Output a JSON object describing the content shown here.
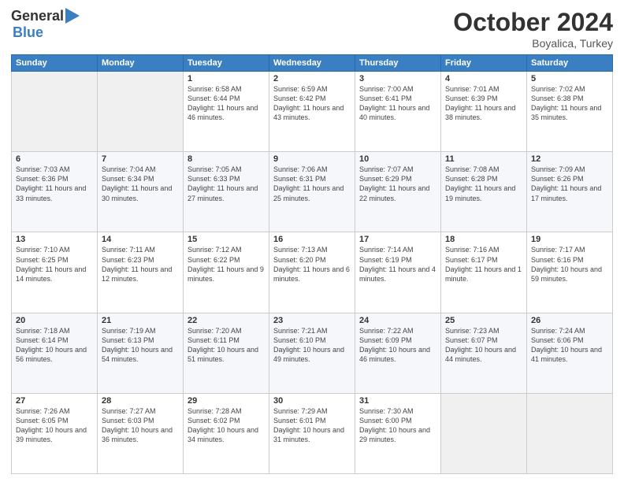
{
  "logo": {
    "general": "General",
    "blue": "Blue"
  },
  "header": {
    "month": "October 2024",
    "location": "Boyalica, Turkey"
  },
  "weekdays": [
    "Sunday",
    "Monday",
    "Tuesday",
    "Wednesday",
    "Thursday",
    "Friday",
    "Saturday"
  ],
  "weeks": [
    [
      {
        "day": "",
        "sunrise": "",
        "sunset": "",
        "daylight": ""
      },
      {
        "day": "",
        "sunrise": "",
        "sunset": "",
        "daylight": ""
      },
      {
        "day": "1",
        "sunrise": "Sunrise: 6:58 AM",
        "sunset": "Sunset: 6:44 PM",
        "daylight": "Daylight: 11 hours and 46 minutes."
      },
      {
        "day": "2",
        "sunrise": "Sunrise: 6:59 AM",
        "sunset": "Sunset: 6:42 PM",
        "daylight": "Daylight: 11 hours and 43 minutes."
      },
      {
        "day": "3",
        "sunrise": "Sunrise: 7:00 AM",
        "sunset": "Sunset: 6:41 PM",
        "daylight": "Daylight: 11 hours and 40 minutes."
      },
      {
        "day": "4",
        "sunrise": "Sunrise: 7:01 AM",
        "sunset": "Sunset: 6:39 PM",
        "daylight": "Daylight: 11 hours and 38 minutes."
      },
      {
        "day": "5",
        "sunrise": "Sunrise: 7:02 AM",
        "sunset": "Sunset: 6:38 PM",
        "daylight": "Daylight: 11 hours and 35 minutes."
      }
    ],
    [
      {
        "day": "6",
        "sunrise": "Sunrise: 7:03 AM",
        "sunset": "Sunset: 6:36 PM",
        "daylight": "Daylight: 11 hours and 33 minutes."
      },
      {
        "day": "7",
        "sunrise": "Sunrise: 7:04 AM",
        "sunset": "Sunset: 6:34 PM",
        "daylight": "Daylight: 11 hours and 30 minutes."
      },
      {
        "day": "8",
        "sunrise": "Sunrise: 7:05 AM",
        "sunset": "Sunset: 6:33 PM",
        "daylight": "Daylight: 11 hours and 27 minutes."
      },
      {
        "day": "9",
        "sunrise": "Sunrise: 7:06 AM",
        "sunset": "Sunset: 6:31 PM",
        "daylight": "Daylight: 11 hours and 25 minutes."
      },
      {
        "day": "10",
        "sunrise": "Sunrise: 7:07 AM",
        "sunset": "Sunset: 6:29 PM",
        "daylight": "Daylight: 11 hours and 22 minutes."
      },
      {
        "day": "11",
        "sunrise": "Sunrise: 7:08 AM",
        "sunset": "Sunset: 6:28 PM",
        "daylight": "Daylight: 11 hours and 19 minutes."
      },
      {
        "day": "12",
        "sunrise": "Sunrise: 7:09 AM",
        "sunset": "Sunset: 6:26 PM",
        "daylight": "Daylight: 11 hours and 17 minutes."
      }
    ],
    [
      {
        "day": "13",
        "sunrise": "Sunrise: 7:10 AM",
        "sunset": "Sunset: 6:25 PM",
        "daylight": "Daylight: 11 hours and 14 minutes."
      },
      {
        "day": "14",
        "sunrise": "Sunrise: 7:11 AM",
        "sunset": "Sunset: 6:23 PM",
        "daylight": "Daylight: 11 hours and 12 minutes."
      },
      {
        "day": "15",
        "sunrise": "Sunrise: 7:12 AM",
        "sunset": "Sunset: 6:22 PM",
        "daylight": "Daylight: 11 hours and 9 minutes."
      },
      {
        "day": "16",
        "sunrise": "Sunrise: 7:13 AM",
        "sunset": "Sunset: 6:20 PM",
        "daylight": "Daylight: 11 hours and 6 minutes."
      },
      {
        "day": "17",
        "sunrise": "Sunrise: 7:14 AM",
        "sunset": "Sunset: 6:19 PM",
        "daylight": "Daylight: 11 hours and 4 minutes."
      },
      {
        "day": "18",
        "sunrise": "Sunrise: 7:16 AM",
        "sunset": "Sunset: 6:17 PM",
        "daylight": "Daylight: 11 hours and 1 minute."
      },
      {
        "day": "19",
        "sunrise": "Sunrise: 7:17 AM",
        "sunset": "Sunset: 6:16 PM",
        "daylight": "Daylight: 10 hours and 59 minutes."
      }
    ],
    [
      {
        "day": "20",
        "sunrise": "Sunrise: 7:18 AM",
        "sunset": "Sunset: 6:14 PM",
        "daylight": "Daylight: 10 hours and 56 minutes."
      },
      {
        "day": "21",
        "sunrise": "Sunrise: 7:19 AM",
        "sunset": "Sunset: 6:13 PM",
        "daylight": "Daylight: 10 hours and 54 minutes."
      },
      {
        "day": "22",
        "sunrise": "Sunrise: 7:20 AM",
        "sunset": "Sunset: 6:11 PM",
        "daylight": "Daylight: 10 hours and 51 minutes."
      },
      {
        "day": "23",
        "sunrise": "Sunrise: 7:21 AM",
        "sunset": "Sunset: 6:10 PM",
        "daylight": "Daylight: 10 hours and 49 minutes."
      },
      {
        "day": "24",
        "sunrise": "Sunrise: 7:22 AM",
        "sunset": "Sunset: 6:09 PM",
        "daylight": "Daylight: 10 hours and 46 minutes."
      },
      {
        "day": "25",
        "sunrise": "Sunrise: 7:23 AM",
        "sunset": "Sunset: 6:07 PM",
        "daylight": "Daylight: 10 hours and 44 minutes."
      },
      {
        "day": "26",
        "sunrise": "Sunrise: 7:24 AM",
        "sunset": "Sunset: 6:06 PM",
        "daylight": "Daylight: 10 hours and 41 minutes."
      }
    ],
    [
      {
        "day": "27",
        "sunrise": "Sunrise: 7:26 AM",
        "sunset": "Sunset: 6:05 PM",
        "daylight": "Daylight: 10 hours and 39 minutes."
      },
      {
        "day": "28",
        "sunrise": "Sunrise: 7:27 AM",
        "sunset": "Sunset: 6:03 PM",
        "daylight": "Daylight: 10 hours and 36 minutes."
      },
      {
        "day": "29",
        "sunrise": "Sunrise: 7:28 AM",
        "sunset": "Sunset: 6:02 PM",
        "daylight": "Daylight: 10 hours and 34 minutes."
      },
      {
        "day": "30",
        "sunrise": "Sunrise: 7:29 AM",
        "sunset": "Sunset: 6:01 PM",
        "daylight": "Daylight: 10 hours and 31 minutes."
      },
      {
        "day": "31",
        "sunrise": "Sunrise: 7:30 AM",
        "sunset": "Sunset: 6:00 PM",
        "daylight": "Daylight: 10 hours and 29 minutes."
      },
      {
        "day": "",
        "sunrise": "",
        "sunset": "",
        "daylight": ""
      },
      {
        "day": "",
        "sunrise": "",
        "sunset": "",
        "daylight": ""
      }
    ]
  ]
}
